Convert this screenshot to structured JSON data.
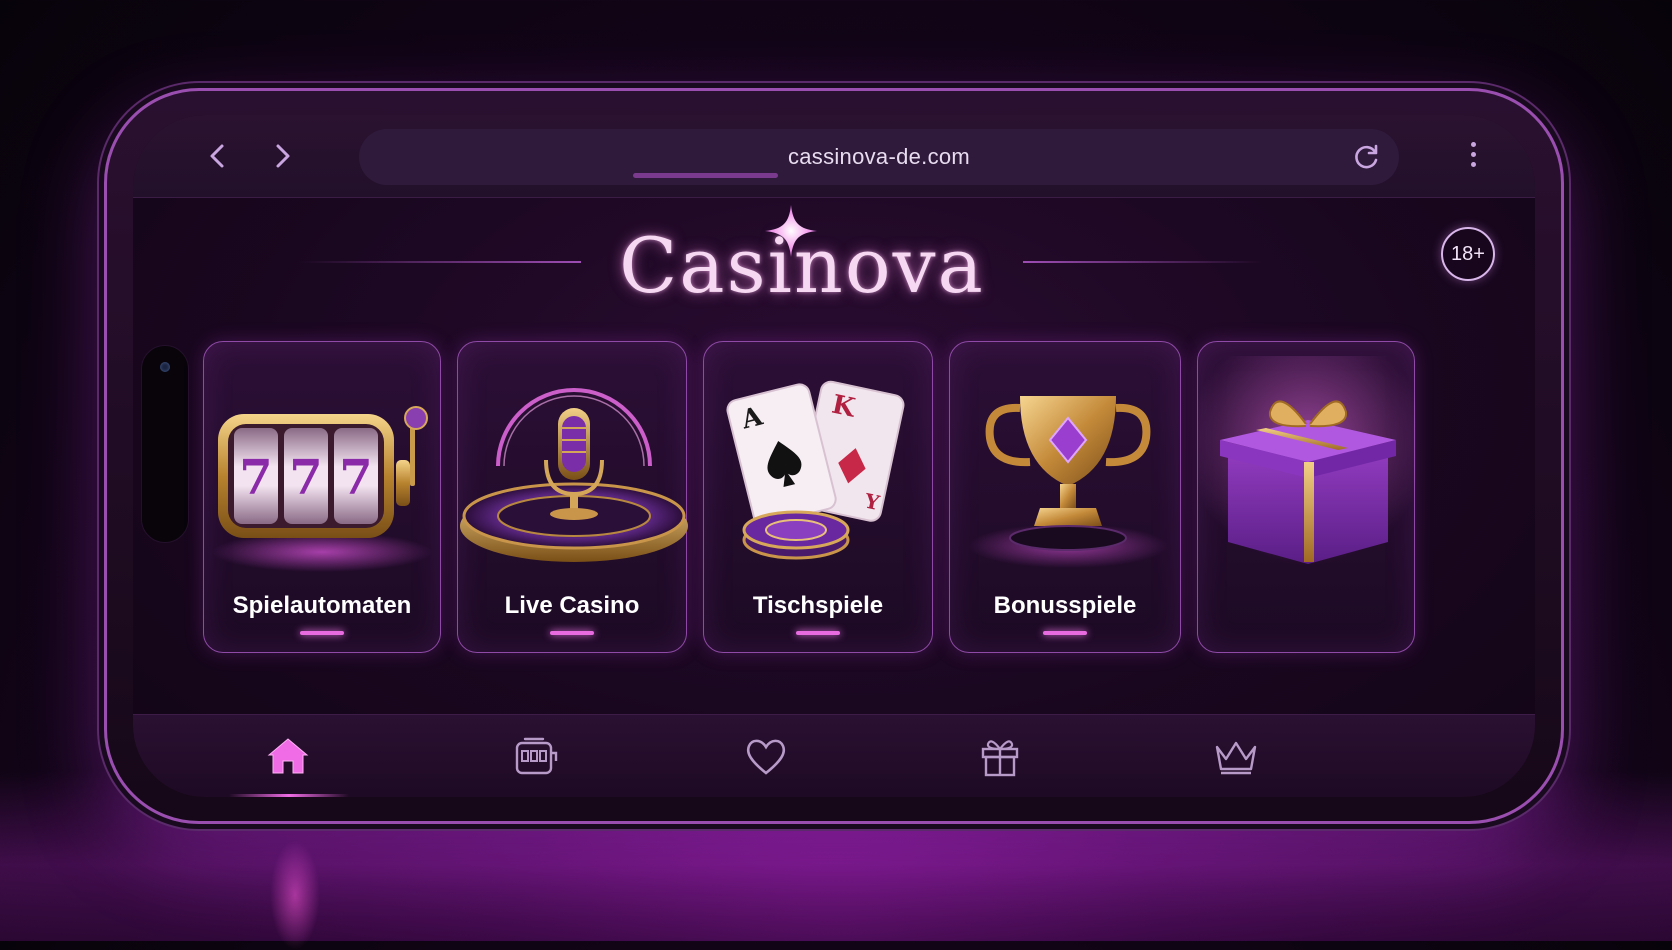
{
  "browser": {
    "url": "cassinova-de.com",
    "back_icon": "chevron-left-icon",
    "forward_icon": "chevron-right-icon",
    "reload_icon": "reload-icon",
    "menu_icon": "more-vertical-icon"
  },
  "header": {
    "brand": "Casinova",
    "age_badge": "18+"
  },
  "categories": [
    {
      "label": "Spielautomaten",
      "icon": "slot-machine-icon"
    },
    {
      "label": "Live Casino",
      "icon": "microphone-roulette-icon"
    },
    {
      "label": "Tischspiele",
      "icon": "playing-cards-icon"
    },
    {
      "label": "Bonusspiele",
      "icon": "trophy-icon"
    },
    {
      "label": "",
      "icon": "gift-box-icon"
    }
  ],
  "bottom_nav": [
    {
      "icon": "home-icon",
      "active": true
    },
    {
      "icon": "slot-machine-icon",
      "active": false
    },
    {
      "icon": "heart-icon",
      "active": false
    },
    {
      "icon": "gift-icon",
      "active": false
    },
    {
      "icon": "crown-icon",
      "active": false
    }
  ],
  "colors": {
    "accent": "#f06ce6",
    "card_border": "#8e4aa6",
    "background": "#14051a",
    "brand_text": "#f6d8f2"
  }
}
